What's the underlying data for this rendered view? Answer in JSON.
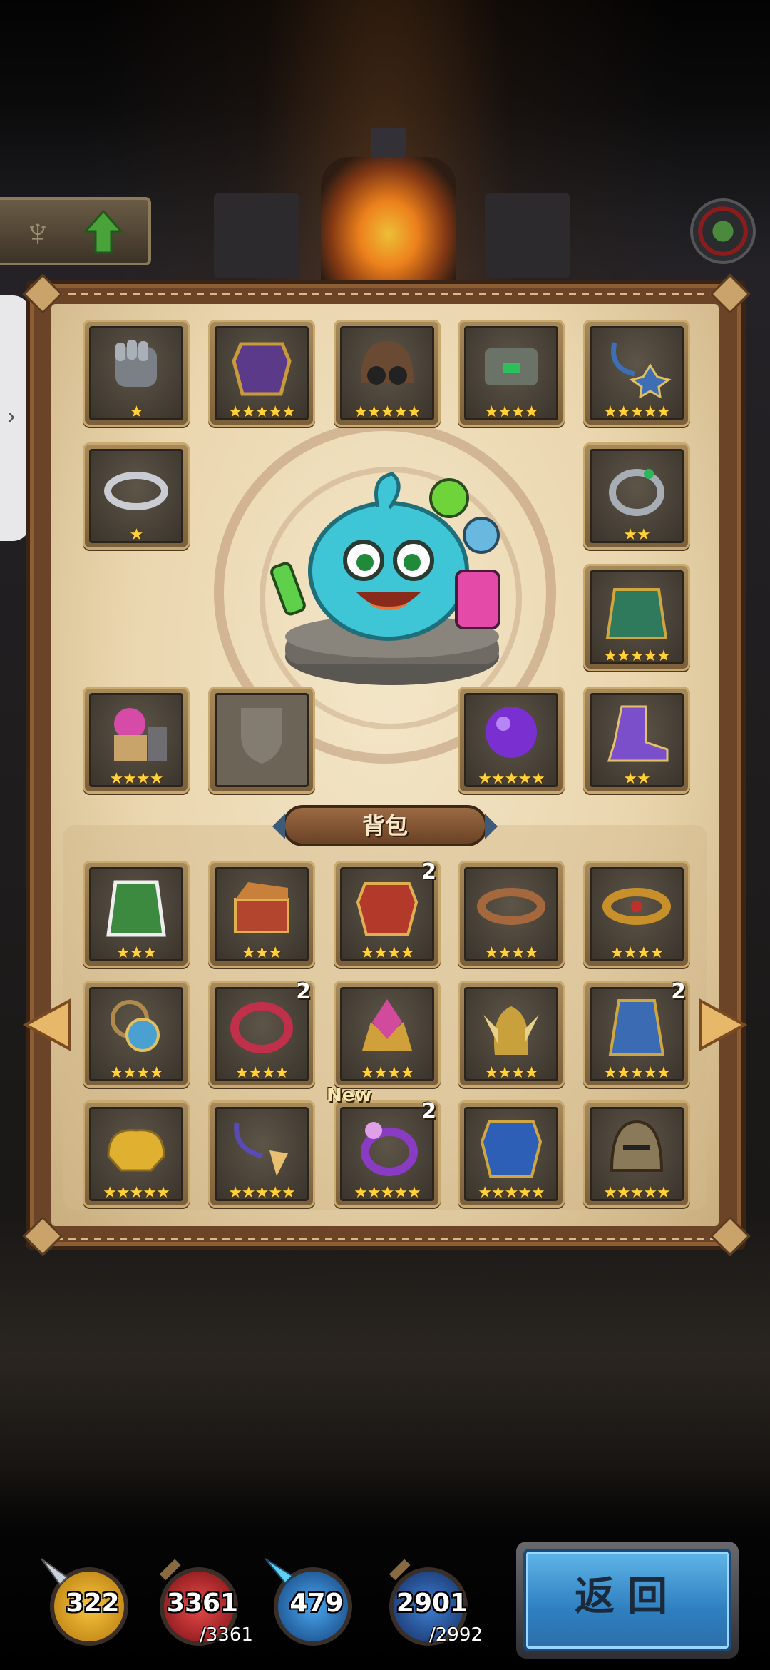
{
  "equipped": [
    {
      "id": "gauntlet",
      "stars": "★",
      "color": "#7b7f86"
    },
    {
      "id": "armor",
      "stars": "★★★★★",
      "color": "#5b3a8a"
    },
    {
      "id": "helmet-goggles",
      "stars": "★★★★★",
      "color": "#6b4a34"
    },
    {
      "id": "cannon",
      "stars": "★★★★",
      "color": "#6b7368"
    },
    {
      "id": "amulet",
      "stars": "★★★★★",
      "color": "#3e6fb5"
    },
    {
      "id": "ring-silver",
      "stars": "★",
      "color": "#c9ccd2"
    },
    {
      "id": "ring-emerald",
      "stars": "★★",
      "color": "#a7adb5"
    },
    {
      "id": "green-cape",
      "stars": "★★★★★",
      "color": "#2f7a5c"
    },
    {
      "id": "alchemy-furnace",
      "stars": "★★★★",
      "color": "#d64aa8"
    },
    {
      "id": "locked-slot",
      "stars": "",
      "color": "#8d877c"
    },
    {
      "id": "purple-orb",
      "stars": "★★★★★",
      "color": "#7a2fd0"
    },
    {
      "id": "purple-boots",
      "stars": "★★",
      "color": "#7b4fc9"
    }
  ],
  "bag": {
    "title": "背包",
    "items": [
      {
        "id": "green-cloak",
        "stars": "★★★",
        "count": "",
        "new": "",
        "color": "#3c8a3f"
      },
      {
        "id": "treasure-chest",
        "stars": "★★★",
        "count": "",
        "new": "",
        "color": "#b3452f"
      },
      {
        "id": "red-armor",
        "stars": "★★★★",
        "count": "2",
        "new": "",
        "color": "#b33a2a"
      },
      {
        "id": "bronze-bracer",
        "stars": "★★★★",
        "count": "",
        "new": "",
        "color": "#a5683c"
      },
      {
        "id": "gold-bracer",
        "stars": "★★★★",
        "count": "",
        "new": "",
        "color": "#c7902b"
      },
      {
        "id": "sapphire-amulet",
        "stars": "★★★★",
        "count": "",
        "new": "",
        "color": "#4aa0d0"
      },
      {
        "id": "ruby-ring",
        "stars": "★★★★",
        "count": "2",
        "new": "",
        "color": "#c0304a"
      },
      {
        "id": "gem-crown",
        "stars": "★★★★",
        "count": "",
        "new": "",
        "color": "#d14a9b"
      },
      {
        "id": "winged-helm",
        "stars": "★★★★",
        "count": "",
        "new": "",
        "color": "#c9a13c"
      },
      {
        "id": "blue-cape",
        "stars": "★★★★★",
        "count": "2",
        "new": "",
        "color": "#3a6bb3"
      },
      {
        "id": "gold-pauldrons",
        "stars": "★★★★★",
        "count": "",
        "new": "",
        "color": "#e0b030"
      },
      {
        "id": "pendant",
        "stars": "★★★★★",
        "count": "",
        "new": "",
        "color": "#5a4ab5"
      },
      {
        "id": "dragon-ring",
        "stars": "★★★★★",
        "count": "2",
        "new": "New",
        "color": "#8a3bc4"
      },
      {
        "id": "sapphire-armor",
        "stars": "★★★★★",
        "count": "",
        "new": "",
        "color": "#2c5fb5"
      },
      {
        "id": "iron-helm",
        "stars": "★★★★★",
        "count": "",
        "new": "",
        "color": "#8a7a5a"
      }
    ]
  },
  "stats": [
    {
      "id": "attack",
      "value": "322",
      "max": "",
      "color": "#d9a21a"
    },
    {
      "id": "hp",
      "value": "3361",
      "max": "/3361",
      "color": "#c0252a"
    },
    {
      "id": "mana",
      "value": "479",
      "max": "",
      "color": "#2a7ac8"
    },
    {
      "id": "exp",
      "value": "2901",
      "max": "/2992",
      "color": "#2f5fae"
    }
  ],
  "return_label": "返回"
}
